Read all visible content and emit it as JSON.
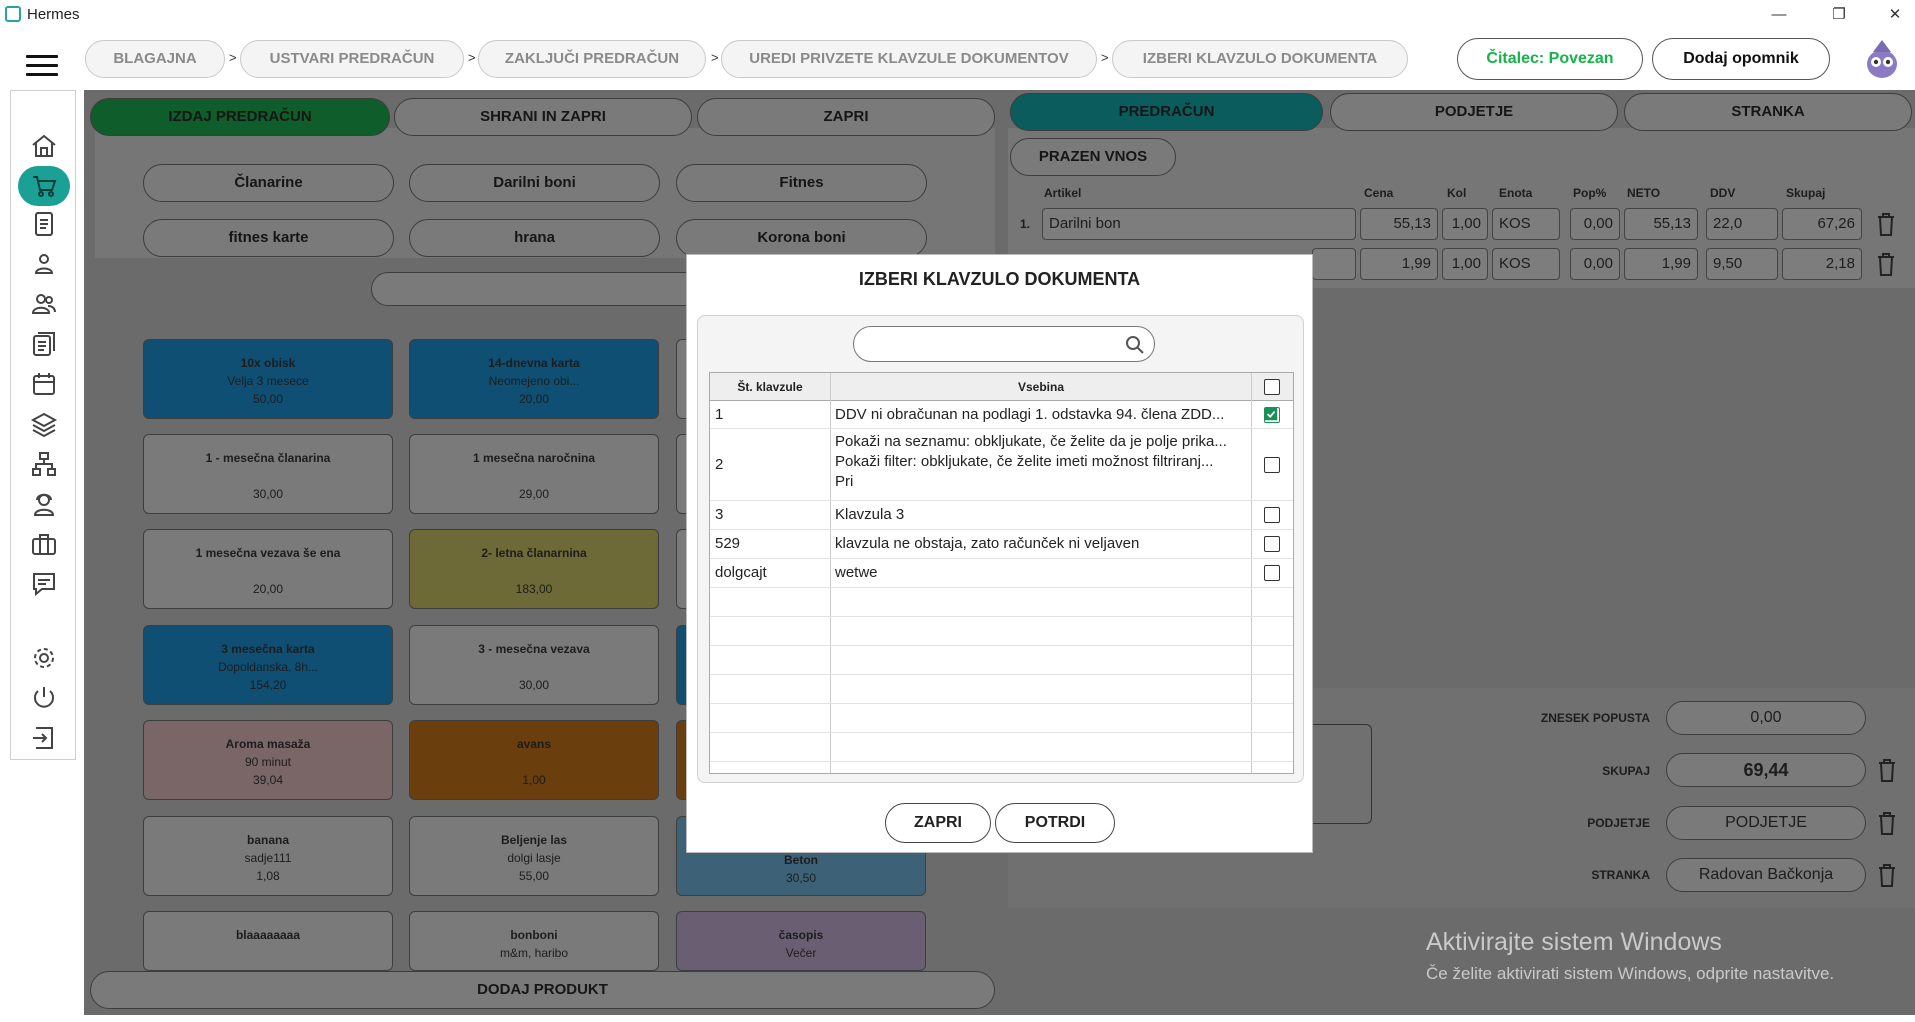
{
  "window": {
    "title": "Hermes",
    "minimize": "—",
    "maximize": "❐",
    "close": "✕"
  },
  "breadcrumb": [
    {
      "label": "BLAGAJNA"
    },
    {
      "label": "USTVARI PREDRAČUN"
    },
    {
      "label": "ZAKLJUČI PREDRAČUN"
    },
    {
      "label": "UREDI PRIVZETE KLAVZULE DOKUMENTOV"
    },
    {
      "label": "IZBERI KLAVZULO DOKUMENTA"
    }
  ],
  "breadcrumb_separator": ">",
  "header": {
    "reader_status": "Čitalec: Povezan",
    "add_reminder": "Dodaj opomnik"
  },
  "left_panel": {
    "tabs": [
      "IZDAJ PREDRAČUN",
      "SHRANI IN ZAPRI",
      "ZAPRI"
    ],
    "categories": [
      "Članarine",
      "Darilni boni",
      "Fitnes",
      "fitnes karte",
      "hrana",
      "Korona boni"
    ],
    "products": [
      {
        "name": "10x obisk",
        "sub": "Velja 3 mesece",
        "price": "50,00",
        "color": "blue"
      },
      {
        "name": "14-dnevna karta",
        "sub": "Neomejeno obi...",
        "price": "20,00",
        "color": "blue"
      },
      {
        "name": "1 - mesečna članarina",
        "sub": "",
        "price": "30,00",
        "color": "gray"
      },
      {
        "name": "1 mesečna naročnina",
        "sub": "",
        "price": "29,00",
        "color": "gray"
      },
      {
        "name": "1 mesečna vezava še ena",
        "sub": "",
        "price": "20,00",
        "color": "gray"
      },
      {
        "name": "2- letna članarnina",
        "sub": "",
        "price": "183,00",
        "color": "olive"
      },
      {
        "name": "3 mesečna karta",
        "sub": "Dopoldanska, 8h...",
        "price": "154,20",
        "color": "blue"
      },
      {
        "name": "3 - mesečna vezava",
        "sub": "",
        "price": "30,00",
        "color": "gray"
      },
      {
        "name": "Aroma masaža",
        "sub": "90 minut",
        "price": "39,04",
        "color": "rose"
      },
      {
        "name": "avans",
        "sub": "",
        "price": "1,00",
        "color": "orange"
      },
      {
        "name": "banana",
        "sub": "sadje111",
        "price": "1,08",
        "color": "gray"
      },
      {
        "name": "Beljenje las",
        "sub": "dolgi lasje",
        "price": "55,00",
        "color": "gray"
      },
      {
        "name": "blaaaaaaaa",
        "sub": "",
        "price": "",
        "color": "gray"
      },
      {
        "name": "bonboni",
        "sub": "m&m, haribo",
        "price": "",
        "color": "gray"
      },
      {
        "name": "časopis",
        "sub": "Večer",
        "price": "",
        "color": "violet"
      }
    ],
    "partial_tile": {
      "name": "Beton",
      "price": "30,50"
    },
    "add_product": "DODAJ PRODUKT"
  },
  "right_panel": {
    "tabs": [
      "PREDRAČUN",
      "PODJETJE",
      "STRANKA"
    ],
    "empty_entry": "PRAZEN VNOS",
    "columns": [
      "Artikel",
      "Cena",
      "Kol",
      "Enota",
      "Pop%",
      "NETO",
      "DDV",
      "Skupaj"
    ],
    "lines": [
      {
        "no": "1.",
        "item": "Darilni bon",
        "price": "55,13",
        "qty": "1,00",
        "unit": "KOS",
        "disc": "0,00",
        "net": "55,13",
        "vat": "22,0",
        "total": "67,26"
      },
      {
        "no": "",
        "item": "",
        "price": "1,99",
        "qty": "1,00",
        "unit": "KOS",
        "disc": "0,00",
        "net": "1,99",
        "vat": "9,50",
        "total": "2,18"
      }
    ],
    "summary": [
      {
        "label": "ZNESEK POPUSTA",
        "value": "0,00"
      },
      {
        "label": "SKUPAJ",
        "value": "69,44"
      },
      {
        "label": "PODJETJE",
        "value": "PODJETJE"
      },
      {
        "label": "STRANKA",
        "value": "Radovan Bačkonja"
      }
    ]
  },
  "modal": {
    "title": "IZBERI KLAVZULO DOKUMENTA",
    "search_placeholder": "",
    "columns": {
      "number": "Št. klavzule",
      "content": "Vsebina"
    },
    "rows": [
      {
        "number": "1",
        "content": [
          "DDV ni obračunan na podlagi 1. odstavka 94. člena ZDD..."
        ],
        "checked": true
      },
      {
        "number": "2",
        "content": [
          "Pokaži na seznamu: obkljukate, če želite da je polje prika...",
          "Pokaži filter: obkljukate, če želite imeti možnost filtriranj...",
          "Pri"
        ],
        "checked": false
      },
      {
        "number": "3",
        "content": [
          "Klavzula 3"
        ],
        "checked": false
      },
      {
        "number": "529",
        "content": [
          "klavzula ne obstaja, zato računček ni veljaven"
        ],
        "checked": false
      },
      {
        "number": "dolgcajt",
        "content": [
          "wetwe"
        ],
        "checked": false
      }
    ],
    "cancel": "ZAPRI",
    "confirm": "POTRDI"
  },
  "watermark": {
    "line1": "Aktivirajte sistem Windows",
    "line2": "Če želite aktivirati sistem Windows, odprite nastavitve."
  },
  "colors": {
    "accent_teal": "#1ba095",
    "check_green": "#1a8f58",
    "status_green": "#17b24a"
  }
}
